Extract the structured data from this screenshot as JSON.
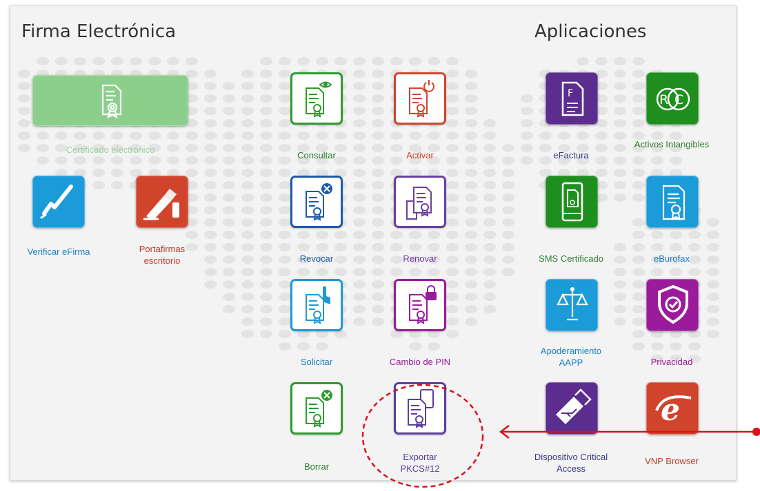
{
  "sections": {
    "firma": {
      "title": "Firma Electrónica"
    },
    "apps": {
      "title": "Aplicaciones"
    }
  },
  "firma_items": [
    {
      "label": "Certificado electrónico",
      "icon": "certificate-icon",
      "color": "#8ccf8c"
    },
    {
      "label": "Verificar eFirma",
      "icon": "checkmark-signature-icon",
      "color": "#1b9bd7"
    },
    {
      "label": "Portafirmas escritorio",
      "icon": "pen-hand-icon",
      "color": "#d1442c"
    },
    {
      "label": "Consultar",
      "icon": "certificate-eye-icon",
      "color": "#2e9a2e"
    },
    {
      "label": "Activar",
      "icon": "certificate-power-icon",
      "color": "#d1442c"
    },
    {
      "label": "Revocar",
      "icon": "certificate-cross-icon",
      "color": "#1f5aa8"
    },
    {
      "label": "Renovar",
      "icon": "certificate-stack-icon",
      "color": "#6b3f9e"
    },
    {
      "label": "Solicitar",
      "icon": "certificate-hand-icon",
      "color": "#1b9bd7"
    },
    {
      "label": "Cambio de PIN",
      "icon": "certificate-lock-icon",
      "color": "#9b1c9b"
    },
    {
      "label": "Borrar",
      "icon": "certificate-delete-icon",
      "color": "#2e9a2e"
    },
    {
      "label": "Exportar PKCS#12",
      "icon": "certificate-export-icon",
      "color": "#5a3f9e"
    }
  ],
  "app_items": [
    {
      "label": "eFactura",
      "icon": "invoice-icon",
      "color": "#5b2d8e"
    },
    {
      "label": "Activos Intangibles",
      "icon": "rc-logo-icon",
      "color": "#1e8f1e"
    },
    {
      "label": "SMS Certificado",
      "icon": "phone-certificate-icon",
      "color": "#1e8f1e"
    },
    {
      "label": "eBurofax",
      "icon": "certificate-icon",
      "color": "#1b9bd7"
    },
    {
      "label": "Apoderamiento AAPP",
      "icon": "scales-icon",
      "color": "#1b9bd7"
    },
    {
      "label": "Privacidad",
      "icon": "shield-check-icon",
      "color": "#9b1c9b"
    },
    {
      "label": "Dispositivo Critical Access",
      "icon": "usb-drive-icon",
      "color": "#5b2d8e"
    },
    {
      "label": "VNP Browser",
      "icon": "internet-explorer-icon",
      "color": "#d1442c"
    }
  ],
  "callout": {
    "color": "#d9111b"
  }
}
